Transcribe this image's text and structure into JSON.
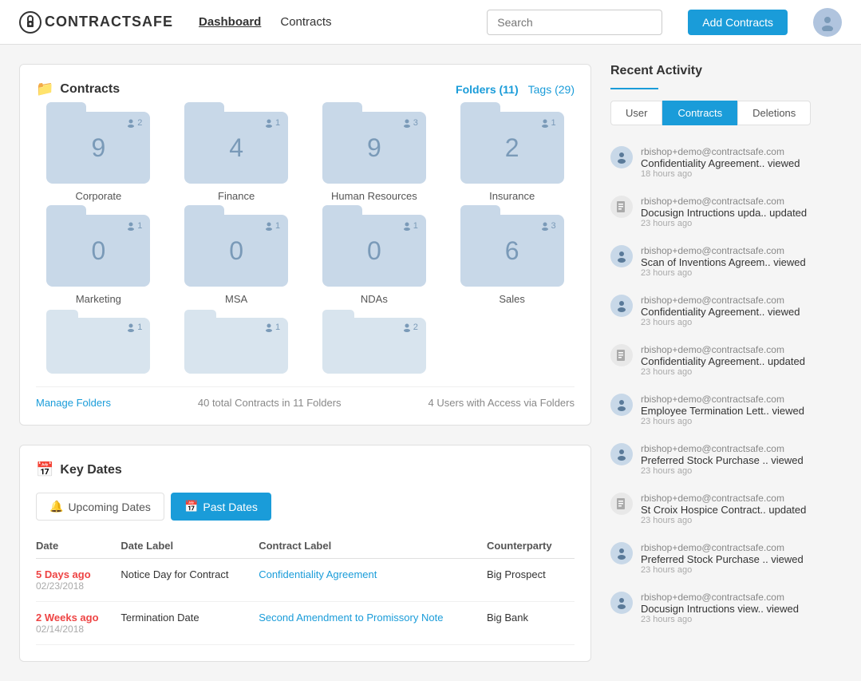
{
  "header": {
    "logo_text": "CONTRACTSAFE",
    "nav": [
      {
        "label": "Dashboard",
        "active": true
      },
      {
        "label": "Contracts",
        "active": false
      }
    ],
    "search_placeholder": "Search",
    "add_button": "Add Contracts"
  },
  "contracts_section": {
    "title": "Contracts",
    "folders_link": "Folders (11)",
    "tags_link": "Tags (29)",
    "folders": [
      {
        "name": "Corporate",
        "count": "9",
        "users": "2"
      },
      {
        "name": "Finance",
        "count": "4",
        "users": "1"
      },
      {
        "name": "Human Resources",
        "count": "9",
        "users": "3"
      },
      {
        "name": "Insurance",
        "count": "2",
        "users": "1"
      },
      {
        "name": "Marketing",
        "count": "0",
        "users": "1"
      },
      {
        "name": "MSA",
        "count": "0",
        "users": "1"
      },
      {
        "name": "NDAs",
        "count": "0",
        "users": "1"
      },
      {
        "name": "Sales",
        "count": "6",
        "users": "3"
      }
    ],
    "extra_folders": [
      {
        "users": "1"
      },
      {
        "users": "1"
      },
      {
        "users": "2"
      }
    ],
    "manage_label": "Manage Folders",
    "footer_text": "40 total Contracts in 11 Folders",
    "footer_text2": "4 Users with Access via Folders"
  },
  "key_dates_section": {
    "title": "Key Dates",
    "tab_upcoming": "Upcoming Dates",
    "tab_past": "Past Dates",
    "columns": [
      "Date",
      "Date Label",
      "Contract Label",
      "Counterparty"
    ],
    "rows": [
      {
        "ago": "5 Days ago",
        "date": "02/23/2018",
        "label": "Notice Day for Contract",
        "contract": "Confidentiality Agreement",
        "counterparty": "Big Prospect"
      },
      {
        "ago": "2 Weeks ago",
        "date": "02/14/2018",
        "label": "Termination Date",
        "contract": "Second Amendment to Promissory Note",
        "counterparty": "Big Bank"
      }
    ]
  },
  "recent_activity": {
    "title": "Recent Activity",
    "tabs": [
      "User",
      "Contracts",
      "Deletions"
    ],
    "active_tab": "Contracts",
    "items": [
      {
        "type": "person",
        "user": "rbishop+demo@contractsafe.com",
        "action": "Confidentiality Agreement.. viewed",
        "time": "18 hours ago"
      },
      {
        "type": "doc",
        "user": "rbishop+demo@contractsafe.com",
        "action": "Docusign Intructions upda.. updated",
        "time": "23 hours ago"
      },
      {
        "type": "person",
        "user": "rbishop+demo@contractsafe.com",
        "action": "Scan of Inventions Agreem.. viewed",
        "time": "23 hours ago"
      },
      {
        "type": "person",
        "user": "rbishop+demo@contractsafe.com",
        "action": "Confidentiality Agreement.. viewed",
        "time": "23 hours ago"
      },
      {
        "type": "doc",
        "user": "rbishop+demo@contractsafe.com",
        "action": "Confidentiality Agreement.. updated",
        "time": "23 hours ago"
      },
      {
        "type": "person",
        "user": "rbishop+demo@contractsafe.com",
        "action": "Employee Termination Lett.. viewed",
        "time": "23 hours ago"
      },
      {
        "type": "person",
        "user": "rbishop+demo@contractsafe.com",
        "action": "Preferred Stock Purchase .. viewed",
        "time": "23 hours ago"
      },
      {
        "type": "doc",
        "user": "rbishop+demo@contractsafe.com",
        "action": "St Croix Hospice Contract.. updated",
        "time": "23 hours ago"
      },
      {
        "type": "person",
        "user": "rbishop+demo@contractsafe.com",
        "action": "Preferred Stock Purchase .. viewed",
        "time": "23 hours ago"
      },
      {
        "type": "person",
        "user": "rbishop+demo@contractsafe.com",
        "action": "Docusign Intructions view.. viewed",
        "time": "23 hours ago"
      }
    ]
  }
}
